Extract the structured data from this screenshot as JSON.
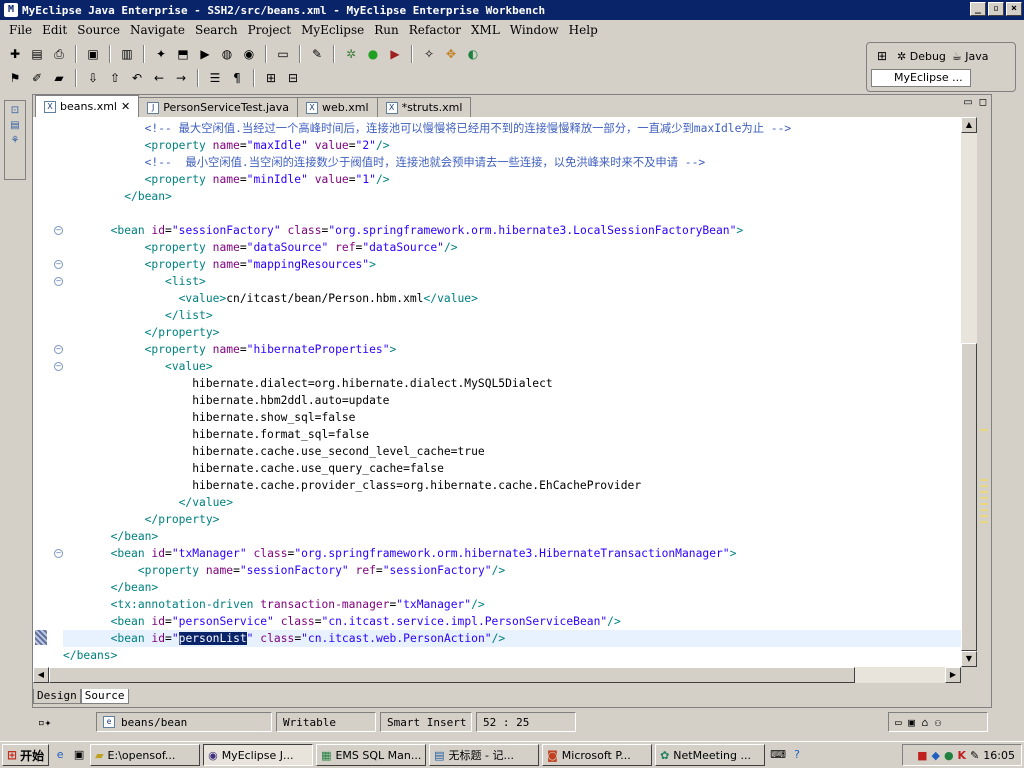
{
  "window": {
    "title": "MyEclipse Java Enterprise - SSH2/src/beans.xml - MyEclipse Enterprise Workbench"
  },
  "menu": [
    "File",
    "Edit",
    "Source",
    "Navigate",
    "Search",
    "Project",
    "MyEclipse",
    "Run",
    "Refactor",
    "XML",
    "Window",
    "Help"
  ],
  "perspectives": {
    "debug": "Debug",
    "java": "Java",
    "myeclipse": "MyEclipse ..."
  },
  "tabs": [
    {
      "label": "beans.xml",
      "icon": "xml-file-icon",
      "active": true
    },
    {
      "label": "PersonServiceTest.java",
      "icon": "java-file-icon",
      "active": false
    },
    {
      "label": "web.xml",
      "icon": "xml-file-icon",
      "active": false
    },
    {
      "label": "*struts.xml",
      "icon": "xml-file-icon",
      "active": false
    }
  ],
  "code_lines": [
    {
      "indent": "            ",
      "tokens": [
        [
          "cmt",
          "<!-- 最大空闲值.当经过一个高峰时间后，连接池可以慢慢将已经用不到的连接慢慢释放一部分，一直减少到maxIdle为止 -->"
        ]
      ]
    },
    {
      "indent": "            ",
      "tokens": [
        [
          "tag",
          "<property "
        ],
        [
          "attr",
          "name"
        ],
        [
          "txt",
          "="
        ],
        [
          "val",
          "\"maxIdle\""
        ],
        [
          "txt",
          " "
        ],
        [
          "attr",
          "value"
        ],
        [
          "txt",
          "="
        ],
        [
          "val",
          "\"2\""
        ],
        [
          "tag",
          "/>"
        ]
      ]
    },
    {
      "indent": "            ",
      "tokens": [
        [
          "cmt",
          "<!--  最小空闲值.当空闲的连接数少于阀值时，连接池就会预申请去一些连接，以免洪峰来时来不及申请 -->"
        ]
      ]
    },
    {
      "indent": "            ",
      "tokens": [
        [
          "tag",
          "<property "
        ],
        [
          "attr",
          "name"
        ],
        [
          "txt",
          "="
        ],
        [
          "val",
          "\"minIdle\""
        ],
        [
          "txt",
          " "
        ],
        [
          "attr",
          "value"
        ],
        [
          "txt",
          "="
        ],
        [
          "val",
          "\"1\""
        ],
        [
          "tag",
          "/>"
        ]
      ]
    },
    {
      "indent": "         ",
      "tokens": [
        [
          "tag",
          "</bean>"
        ]
      ]
    },
    {
      "indent": "",
      "tokens": []
    },
    {
      "indent": "       ",
      "fold": true,
      "tokens": [
        [
          "tag",
          "<bean "
        ],
        [
          "attr",
          "id"
        ],
        [
          "txt",
          "="
        ],
        [
          "val",
          "\"sessionFactory\""
        ],
        [
          "txt",
          " "
        ],
        [
          "attr",
          "class"
        ],
        [
          "txt",
          "="
        ],
        [
          "val",
          "\"org.springframework.orm.hibernate3.LocalSessionFactoryBean\""
        ],
        [
          "tag",
          ">"
        ]
      ]
    },
    {
      "indent": "            ",
      "tokens": [
        [
          "tag",
          "<property "
        ],
        [
          "attr",
          "name"
        ],
        [
          "txt",
          "="
        ],
        [
          "val",
          "\"dataSource\""
        ],
        [
          "txt",
          " "
        ],
        [
          "attr",
          "ref"
        ],
        [
          "txt",
          "="
        ],
        [
          "val",
          "\"dataSource\""
        ],
        [
          "tag",
          "/>"
        ]
      ]
    },
    {
      "indent": "            ",
      "fold": true,
      "tokens": [
        [
          "tag",
          "<property "
        ],
        [
          "attr",
          "name"
        ],
        [
          "txt",
          "="
        ],
        [
          "val",
          "\"mappingResources\""
        ],
        [
          "tag",
          ">"
        ]
      ]
    },
    {
      "indent": "               ",
      "fold": true,
      "tokens": [
        [
          "tag",
          "<list>"
        ]
      ]
    },
    {
      "indent": "                 ",
      "tokens": [
        [
          "tag",
          "<value>"
        ],
        [
          "txt",
          "cn/itcast/bean/Person.hbm.xml"
        ],
        [
          "tag",
          "</value>"
        ]
      ]
    },
    {
      "indent": "               ",
      "tokens": [
        [
          "tag",
          "</list>"
        ]
      ]
    },
    {
      "indent": "            ",
      "tokens": [
        [
          "tag",
          "</property>"
        ]
      ]
    },
    {
      "indent": "            ",
      "fold": true,
      "tokens": [
        [
          "tag",
          "<property "
        ],
        [
          "attr",
          "name"
        ],
        [
          "txt",
          "="
        ],
        [
          "val",
          "\"hibernateProperties\""
        ],
        [
          "tag",
          ">"
        ]
      ]
    },
    {
      "indent": "               ",
      "fold": true,
      "tokens": [
        [
          "tag",
          "<value>"
        ]
      ]
    },
    {
      "indent": "                   ",
      "tokens": [
        [
          "txt",
          "hibernate.dialect=org.hibernate.dialect.MySQL5Dialect"
        ]
      ]
    },
    {
      "indent": "                   ",
      "tokens": [
        [
          "txt",
          "hibernate.hbm2ddl.auto=update"
        ]
      ]
    },
    {
      "indent": "                   ",
      "tokens": [
        [
          "txt",
          "hibernate.show_sql=false"
        ]
      ]
    },
    {
      "indent": "                   ",
      "tokens": [
        [
          "txt",
          "hibernate.format_sql=false"
        ]
      ]
    },
    {
      "indent": "                   ",
      "tokens": [
        [
          "txt",
          "hibernate.cache.use_second_level_cache=true"
        ]
      ]
    },
    {
      "indent": "                   ",
      "tokens": [
        [
          "txt",
          "hibernate.cache.use_query_cache=false"
        ]
      ]
    },
    {
      "indent": "                   ",
      "tokens": [
        [
          "txt",
          "hibernate.cache.provider_class=org.hibernate.cache.EhCacheProvider"
        ]
      ]
    },
    {
      "indent": "                 ",
      "tokens": [
        [
          "tag",
          "</value>"
        ]
      ]
    },
    {
      "indent": "            ",
      "tokens": [
        [
          "tag",
          "</property>"
        ]
      ]
    },
    {
      "indent": "       ",
      "tokens": [
        [
          "tag",
          "</bean>"
        ]
      ]
    },
    {
      "indent": "       ",
      "fold": true,
      "tokens": [
        [
          "tag",
          "<bean "
        ],
        [
          "attr",
          "id"
        ],
        [
          "txt",
          "="
        ],
        [
          "val",
          "\"txManager\""
        ],
        [
          "txt",
          " "
        ],
        [
          "attr",
          "class"
        ],
        [
          "txt",
          "="
        ],
        [
          "val",
          "\"org.springframework.orm.hibernate3.HibernateTransactionManager\""
        ],
        [
          "tag",
          ">"
        ]
      ]
    },
    {
      "indent": "           ",
      "tokens": [
        [
          "tag",
          "<property "
        ],
        [
          "attr",
          "name"
        ],
        [
          "txt",
          "="
        ],
        [
          "val",
          "\"sessionFactory\""
        ],
        [
          "txt",
          " "
        ],
        [
          "attr",
          "ref"
        ],
        [
          "txt",
          "="
        ],
        [
          "val",
          "\"sessionFactory\""
        ],
        [
          "tag",
          "/>"
        ]
      ]
    },
    {
      "indent": "       ",
      "tokens": [
        [
          "tag",
          "</bean>"
        ]
      ]
    },
    {
      "indent": "       ",
      "tokens": [
        [
          "tag",
          "<tx:annotation-driven "
        ],
        [
          "attr",
          "transaction-manager"
        ],
        [
          "txt",
          "="
        ],
        [
          "val",
          "\"txManager\""
        ],
        [
          "tag",
          "/>"
        ]
      ]
    },
    {
      "indent": "       ",
      "tokens": [
        [
          "tag",
          "<bean "
        ],
        [
          "attr",
          "id"
        ],
        [
          "txt",
          "="
        ],
        [
          "val",
          "\"personService\""
        ],
        [
          "txt",
          " "
        ],
        [
          "attr",
          "class"
        ],
        [
          "txt",
          "="
        ],
        [
          "val",
          "\"cn.itcast.service.impl.PersonServiceBean\""
        ],
        [
          "tag",
          "/>"
        ]
      ]
    },
    {
      "indent": "       ",
      "current": true,
      "tokens": [
        [
          "tag",
          "<bean "
        ],
        [
          "attr",
          "id"
        ],
        [
          "txt",
          "="
        ],
        [
          "val",
          "\""
        ],
        [
          "sel",
          "personList"
        ],
        [
          "val",
          "\""
        ],
        [
          "txt",
          " "
        ],
        [
          "attr",
          "class"
        ],
        [
          "txt",
          "="
        ],
        [
          "val",
          "\"cn.itcast.web.PersonAction\""
        ],
        [
          "tag",
          "/>"
        ]
      ]
    },
    {
      "indent": "",
      "tokens": [
        [
          "tag",
          "</beans>"
        ]
      ]
    }
  ],
  "bottom_tabs": [
    "Design",
    "Source"
  ],
  "status": {
    "breadcrumb": "beans/bean",
    "writable": "Writable",
    "insert_mode": "Smart Insert",
    "position": "52 : 25"
  },
  "taskbar": {
    "start": "开始",
    "tasks": [
      {
        "label": "E:\\opensof...",
        "icon": "folder-icon"
      },
      {
        "label": "MyEclipse J...",
        "icon": "eclipse-icon",
        "active": true
      },
      {
        "label": "EMS SQL Man...",
        "icon": "database-icon"
      },
      {
        "label": "无标题 - 记...",
        "icon": "notepad-icon"
      },
      {
        "label": "Microsoft P...",
        "icon": "powerpoint-icon"
      },
      {
        "label": "NetMeeting ...",
        "icon": "netmeeting-icon"
      }
    ],
    "clock": "16:05"
  }
}
